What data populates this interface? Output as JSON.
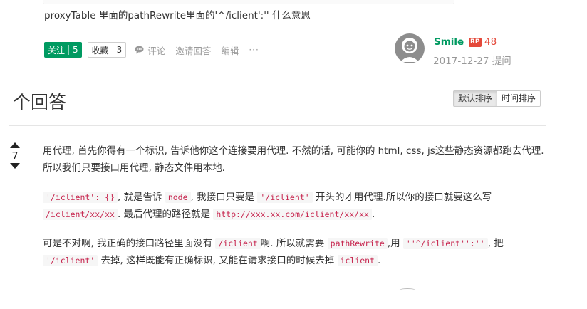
{
  "question": {
    "text": "proxyTable 里面的pathRewrite里面的'^/iclient':'' 什么意思"
  },
  "actions": {
    "follow_label": "关注",
    "follow_count": "5",
    "collect_label": "收藏",
    "collect_count": "3",
    "comment_label": "评论",
    "invite_label": "邀请回答",
    "edit_label": "编辑",
    "more_label": "···"
  },
  "author": {
    "name": "Smile",
    "rep_badge": "RP",
    "reputation": "48",
    "asked_at": "2017-12-27 提问"
  },
  "answers": {
    "heading": "个回答",
    "sort_default": "默认排序",
    "sort_time": "时间排序"
  },
  "answer": {
    "votes": "7",
    "p1": "用代理, 首先你得有一个标识, 告诉他你这个连接要用代理. 不然的话, 可能你的 html, css, js这些静态资源都跑去代理. 所以我们只要接口用代理, 静态文件用本地.",
    "p2": {
      "code1": "'/iclient': {}",
      "t1": ", 就是告诉 ",
      "code2": "node",
      "t2": ", 我接口只要是 ",
      "code3": "'/iclient'",
      "t3": " 开头的才用代理.所以你的接口就要这么写 ",
      "code4": "/iclient/xx/xx",
      "t4": ". 最后代理的路径就是 ",
      "code5": "http://xxx.xx.com/iclient/xx/xx",
      "t5": "."
    },
    "p3": {
      "t1": "可是不对啊, 我正确的接口路径里面没有 ",
      "code1": "/iclient",
      "t2": "啊. 所以就需要 ",
      "code2": "pathRewrite",
      "t3": ",用 ",
      "code3": "''^/iclient'':''",
      "t4": ", 把 ",
      "code4": "'/iclient'",
      "t5": " 去掉, 这样既能有正确标识, 又能在请求接口的时候去掉 ",
      "code5": "iclient",
      "t6": "."
    }
  }
}
